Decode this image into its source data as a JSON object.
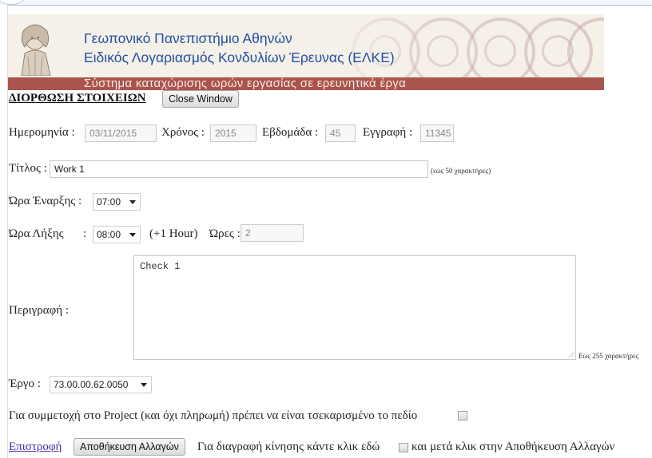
{
  "banner": {
    "university": "Γεωπονικό Πανεπιστήμιο Αθηνών",
    "account": "Ειδικός Λογαριασμός Κονδυλίων Έρευνας (ΕΛΚΕ)",
    "system": "Σύστημα καταχώρισης ωρών εργασίας σε ερευνητικά έργα"
  },
  "heading": "ΔΙΟΡΘΩΣΗ ΣΤΟΙΧΕΙΩΝ",
  "close_button": "Close Window",
  "date_row": {
    "date_label": "Ημερομηνία :",
    "date_value": "03/11/2015",
    "year_label": "Χρόνος :",
    "year_value": "2015",
    "week_label": "Εβδομάδα :",
    "week_value": "45",
    "record_label": "Εγγραφή :",
    "record_value": "11345"
  },
  "title_row": {
    "label": "Τίτλος :",
    "value": "Work 1",
    "hint": "(εως 50 χαρακτήρες)"
  },
  "start_row": {
    "label": "Ώρα Έναρξης :",
    "value": "07:00"
  },
  "end_row": {
    "label": "Ώρα Λήξης",
    "colon": ":",
    "value": "08:00",
    "extra": "(+1 Hour)",
    "hours_label": "Ώρες :",
    "hours_value": "2"
  },
  "description": {
    "label": "Περιγραφή :",
    "value": "Check 1",
    "hint": "Εως 255 χαρακτήρες"
  },
  "project_row": {
    "label": "Έργο :",
    "value": "73.00.00.62.0050"
  },
  "participation_text": "Για συμμετοχή στο Project (και όχι πληρωμή) πρέπει να είναι τσεκαρισμένο το πεδίο",
  "footer": {
    "back_link": "Επιστροφή",
    "save_button": "Αποθήκευση Αλλαγών",
    "delete_text_before": "Για διαγραφή κίνησης κάντε κλικ εδώ",
    "delete_text_after": "και μετά κλικ στην Αποθήκευση Αλλαγών"
  }
}
